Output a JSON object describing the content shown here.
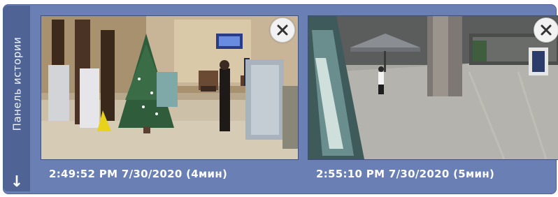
{
  "history_panel": {
    "label": "Панель истории",
    "scroll_icon": "down-arrow-icon",
    "accent_color": "#6a80b4"
  },
  "thumbnails": [
    {
      "timestamp": "2:49:52 PM 7/30/2020 (4мин)",
      "scene": "lobby-christmas-tree",
      "close_icon": "close-icon"
    },
    {
      "timestamp": "2:55:10 PM 7/30/2020 (5мин)",
      "scene": "atrium-cafe",
      "close_icon": "close-icon"
    }
  ]
}
